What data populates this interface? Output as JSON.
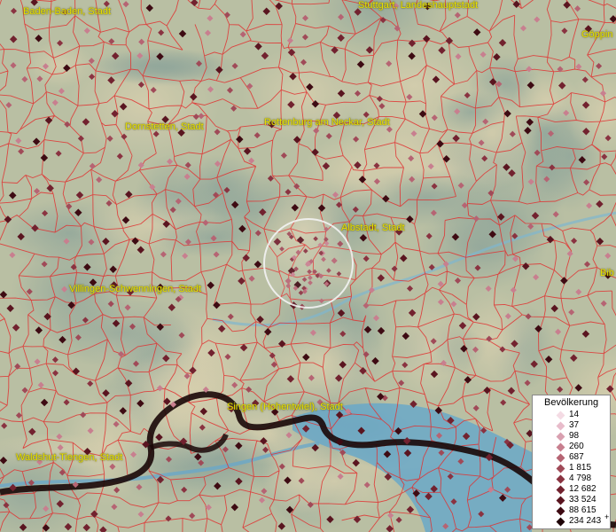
{
  "map": {
    "labels": [
      {
        "id": "baden-baden",
        "text": "Baden-Baden, Stadt"
      },
      {
        "id": "stuttgart",
        "text": "Stuttgart, Landeshauptstadt"
      },
      {
        "id": "goeppingen",
        "text": "Göppin"
      },
      {
        "id": "dornstetten",
        "text": "Dornstetten, Stadt"
      },
      {
        "id": "rottenburg",
        "text": "Rottenburg am Neckar, Stadt"
      },
      {
        "id": "albstadt",
        "text": "Albstadt, Stadt"
      },
      {
        "id": "villingen",
        "text": "Villingen-Schwenningen, Stadt"
      },
      {
        "id": "bib",
        "text": "Bib"
      },
      {
        "id": "singen",
        "text": "Singen (Hohentwiel), Stadt"
      },
      {
        "id": "waldshut",
        "text": "Waldshut-Tiengen, Stadt"
      }
    ],
    "colors": {
      "terrain": "#bfc3a6",
      "boundary": "#e03030",
      "border": "#1a0808",
      "lake": "#6aa8c8",
      "label": "#e8e000"
    }
  },
  "legend": {
    "title": "Bevölkerung",
    "classes": [
      {
        "value": "14",
        "color": "#f4dbe4"
      },
      {
        "value": "37",
        "color": "#e8bccb"
      },
      {
        "value": "98",
        "color": "#d9a0b0"
      },
      {
        "value": "260",
        "color": "#c87f8f"
      },
      {
        "value": "687",
        "color": "#b66473"
      },
      {
        "value": "1 815",
        "color": "#a04a58"
      },
      {
        "value": "4 798",
        "color": "#8a3341"
      },
      {
        "value": "12 682",
        "color": "#72222f"
      },
      {
        "value": "33 524",
        "color": "#5a1520"
      },
      {
        "value": "88 615",
        "color": "#3e0b13"
      },
      {
        "value": "234 243",
        "color": "#1e0307"
      }
    ],
    "plus": "+"
  }
}
